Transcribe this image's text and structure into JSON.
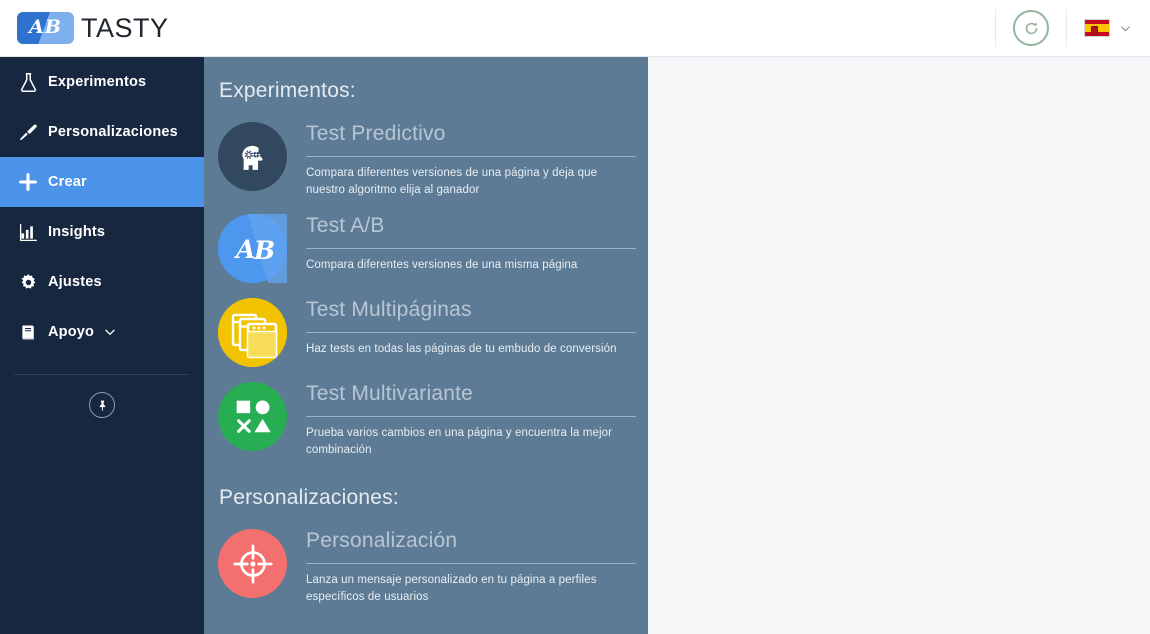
{
  "header": {
    "logo_mark": "AB",
    "logo_text": "TASTY",
    "refresh_icon": "refresh-icon",
    "language": "es",
    "language_chevron": "chevron-down-icon"
  },
  "sidebar": {
    "items": [
      {
        "id": "experimentos",
        "label": "Experimentos",
        "icon": "flask-icon",
        "active": false,
        "chevron": false
      },
      {
        "id": "personalizaciones",
        "label": "Personalizaciones",
        "icon": "paintbrush-icon",
        "active": false,
        "chevron": false
      },
      {
        "id": "crear",
        "label": "Crear",
        "icon": "plus-icon",
        "active": true,
        "chevron": false
      },
      {
        "id": "insights",
        "label": "Insights",
        "icon": "bar-chart-icon",
        "active": false,
        "chevron": false
      },
      {
        "id": "ajustes",
        "label": "Ajustes",
        "icon": "gear-icon",
        "active": false,
        "chevron": false
      },
      {
        "id": "apoyo",
        "label": "Apoyo",
        "icon": "book-icon",
        "active": false,
        "chevron": true
      }
    ],
    "pin_button": "pin-icon"
  },
  "panel": {
    "sections": [
      {
        "id": "experimentos",
        "title": "Experimentos:",
        "cards": [
          {
            "id": "test-predictivo",
            "title": "Test Predictivo",
            "description": "Compara diferentes versiones de una página y deja que nuestro algoritmo elija al ganador",
            "icon": "brain-head-icon",
            "icon_bg": "#32485e"
          },
          {
            "id": "test-ab",
            "title": "Test A/B",
            "description": "Compara diferentes versiones de una misma página",
            "icon": "ab-icon",
            "icon_bg": "#4d97ef"
          },
          {
            "id": "test-multipaginas",
            "title": "Test Multipáginas",
            "description": "Haz tests en todas las páginas de tu embudo de conversión",
            "icon": "multipage-windows-icon",
            "icon_bg": "#f2c300"
          },
          {
            "id": "test-multivariante",
            "title": "Test Multivariante",
            "description": "Prueba varios cambios en una página y encuentra la mejor combinación",
            "icon": "shapes-icon",
            "icon_bg": "#27ae52"
          }
        ]
      },
      {
        "id": "personalizaciones",
        "title": "Personalizaciones:",
        "cards": [
          {
            "id": "personalizacion",
            "title": "Personalización",
            "description": "Lanza un mensaje personalizado en tu página a perfiles específicos de usuarios",
            "icon": "crosshair-target-icon",
            "icon_bg": "#f4706e"
          }
        ]
      }
    ]
  },
  "colors": {
    "sidebar_bg": "#172740",
    "sidebar_active": "#4c93ea",
    "panel_bg": "#5d7b95",
    "header_bg": "#ffffff",
    "main_bg": "#f6f7f9",
    "refresh_green": "#93b49c"
  }
}
